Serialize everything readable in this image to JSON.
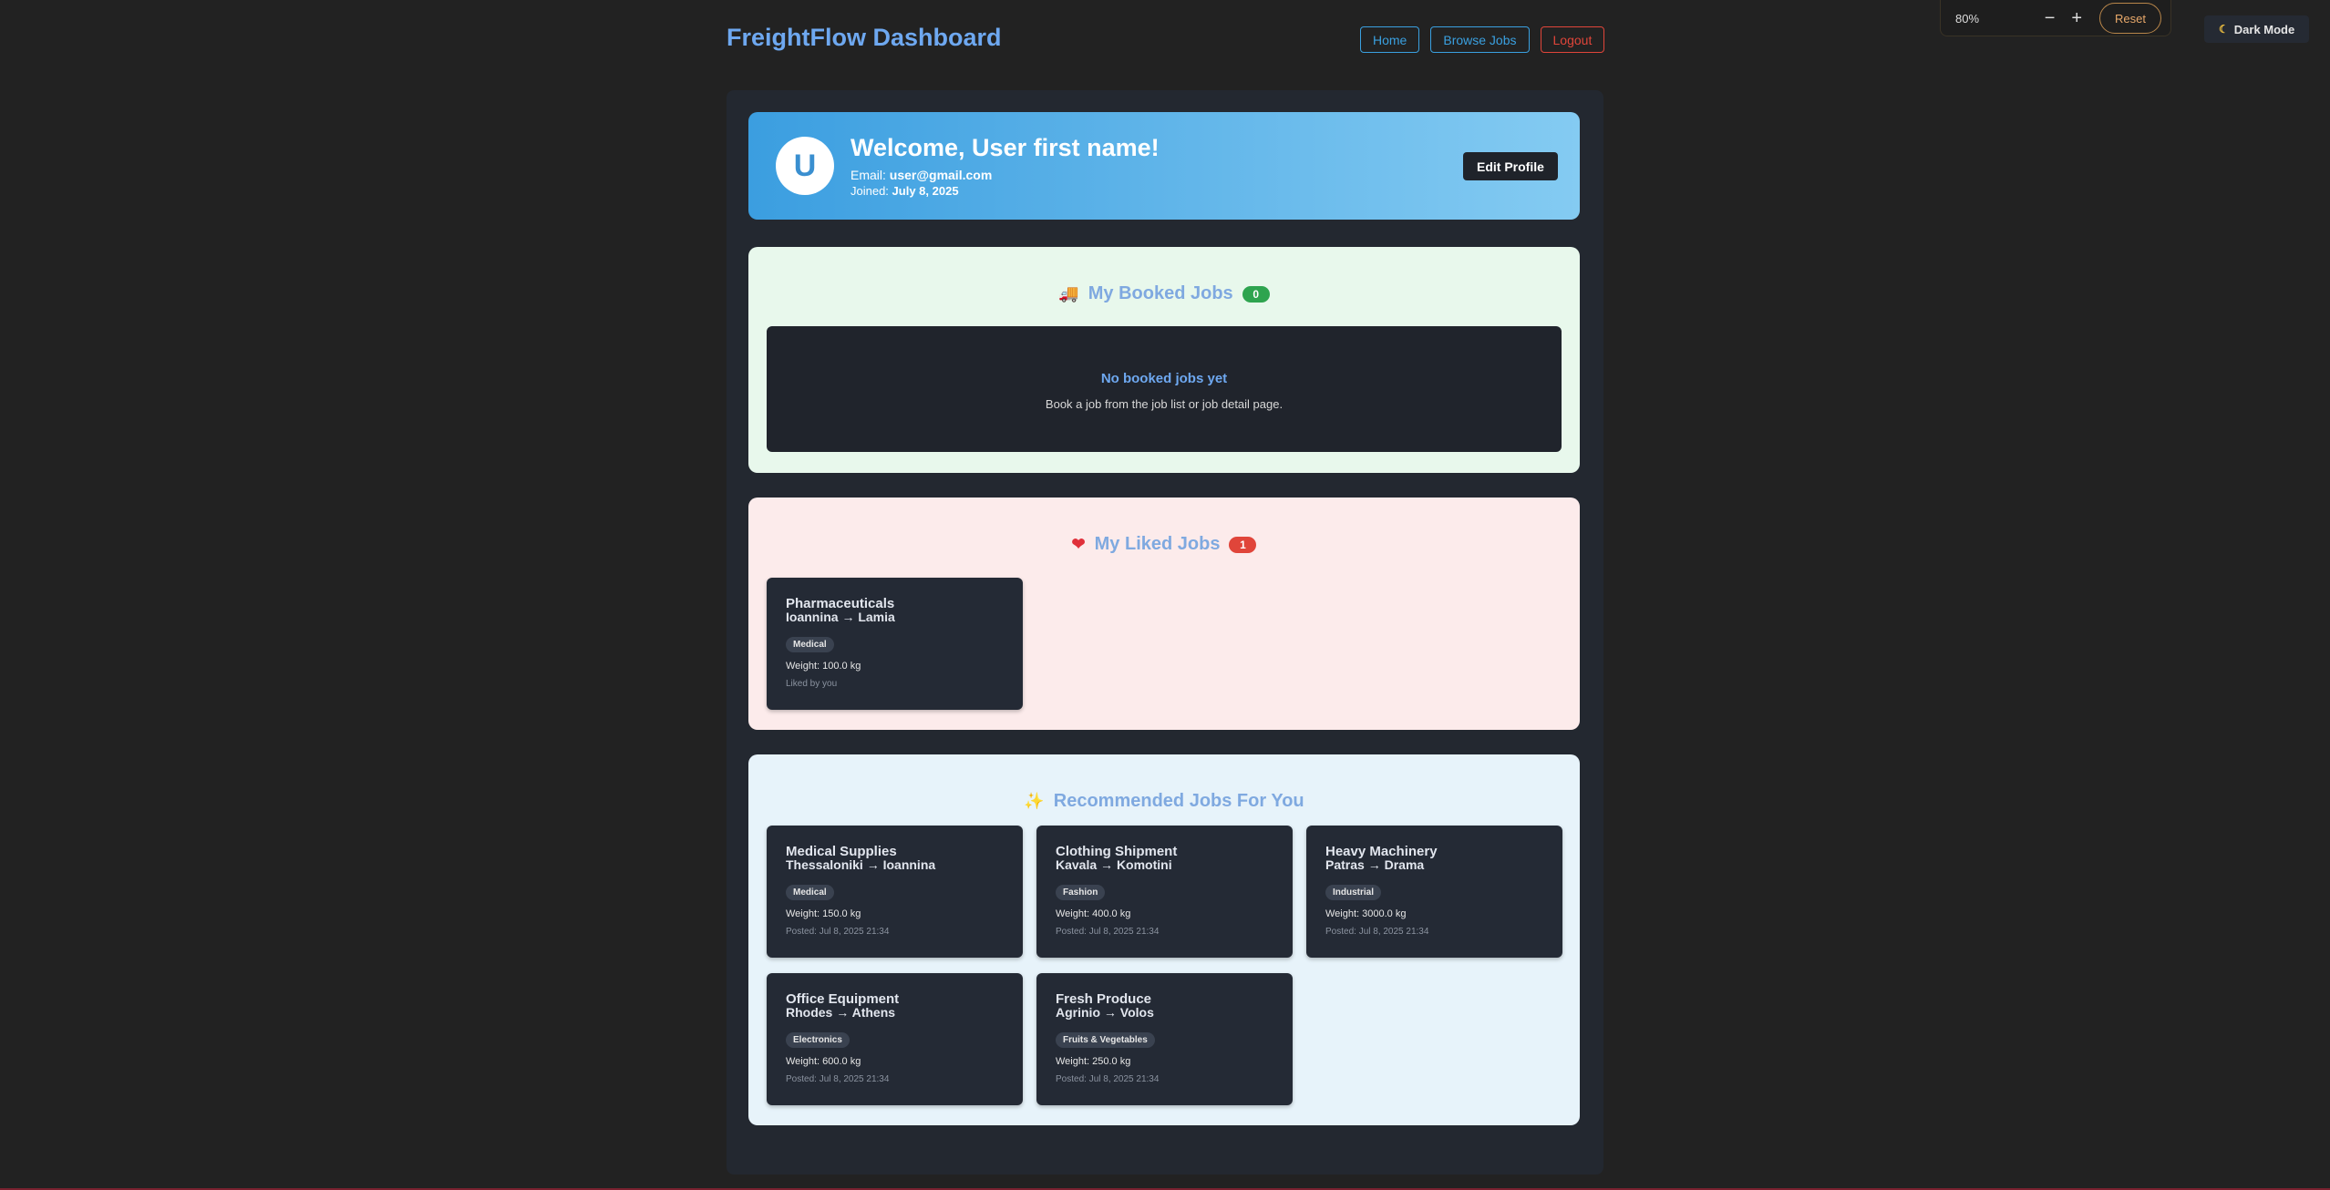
{
  "header": {
    "brand": "FreightFlow Dashboard",
    "nav": {
      "home": "Home",
      "browse": "Browse Jobs",
      "logout": "Logout"
    }
  },
  "zoom": {
    "level": "80%",
    "minus": "−",
    "plus": "+",
    "reset": "Reset"
  },
  "dark_mode": {
    "label": "Dark Mode",
    "icon": "moon-icon"
  },
  "profile": {
    "avatar_letter": "U",
    "welcome": "Welcome, User first name!",
    "email_label": "Email:",
    "email": "user@gmail.com",
    "joined_label": "Joined:",
    "joined": "July 8, 2025",
    "edit_button": "Edit Profile"
  },
  "booked": {
    "icon": "truck-icon",
    "title": "My Booked Jobs",
    "count": "0",
    "empty_title": "No booked jobs yet",
    "empty_text": "Book a job from the job list or job detail page."
  },
  "liked": {
    "icon": "heart-icon",
    "title": "My Liked Jobs",
    "count": "1",
    "jobs": [
      {
        "title": "Pharmaceuticals",
        "from": "Ioannina",
        "to": "Lamia",
        "tag": "Medical",
        "weight": "Weight: 100.0 kg",
        "meta": "Liked by you"
      }
    ]
  },
  "recommended": {
    "icon": "sparkles-icon",
    "title": "Recommended Jobs For You",
    "jobs": [
      {
        "title": "Medical Supplies",
        "from": "Thessaloniki",
        "to": "Ioannina",
        "tag": "Medical",
        "weight": "Weight: 150.0 kg",
        "meta": "Posted: Jul 8, 2025 21:34"
      },
      {
        "title": "Clothing Shipment",
        "from": "Kavala",
        "to": "Komotini",
        "tag": "Fashion",
        "weight": "Weight: 400.0 kg",
        "meta": "Posted: Jul 8, 2025 21:34"
      },
      {
        "title": "Heavy Machinery",
        "from": "Patras",
        "to": "Drama",
        "tag": "Industrial",
        "weight": "Weight: 3000.0 kg",
        "meta": "Posted: Jul 8, 2025 21:34"
      },
      {
        "title": "Office Equipment",
        "from": "Rhodes",
        "to": "Athens",
        "tag": "Electronics",
        "weight": "Weight: 600.0 kg",
        "meta": "Posted: Jul 8, 2025 21:34"
      },
      {
        "title": "Fresh Produce",
        "from": "Agrinio",
        "to": "Volos",
        "tag": "Fruits & Vegetables",
        "weight": "Weight: 250.0 kg",
        "meta": "Posted: Jul 8, 2025 21:34"
      }
    ]
  },
  "route_arrow": "→",
  "colors": {
    "accent": "#6ea8f0",
    "success": "#2ea44f",
    "danger": "#e0453a"
  }
}
